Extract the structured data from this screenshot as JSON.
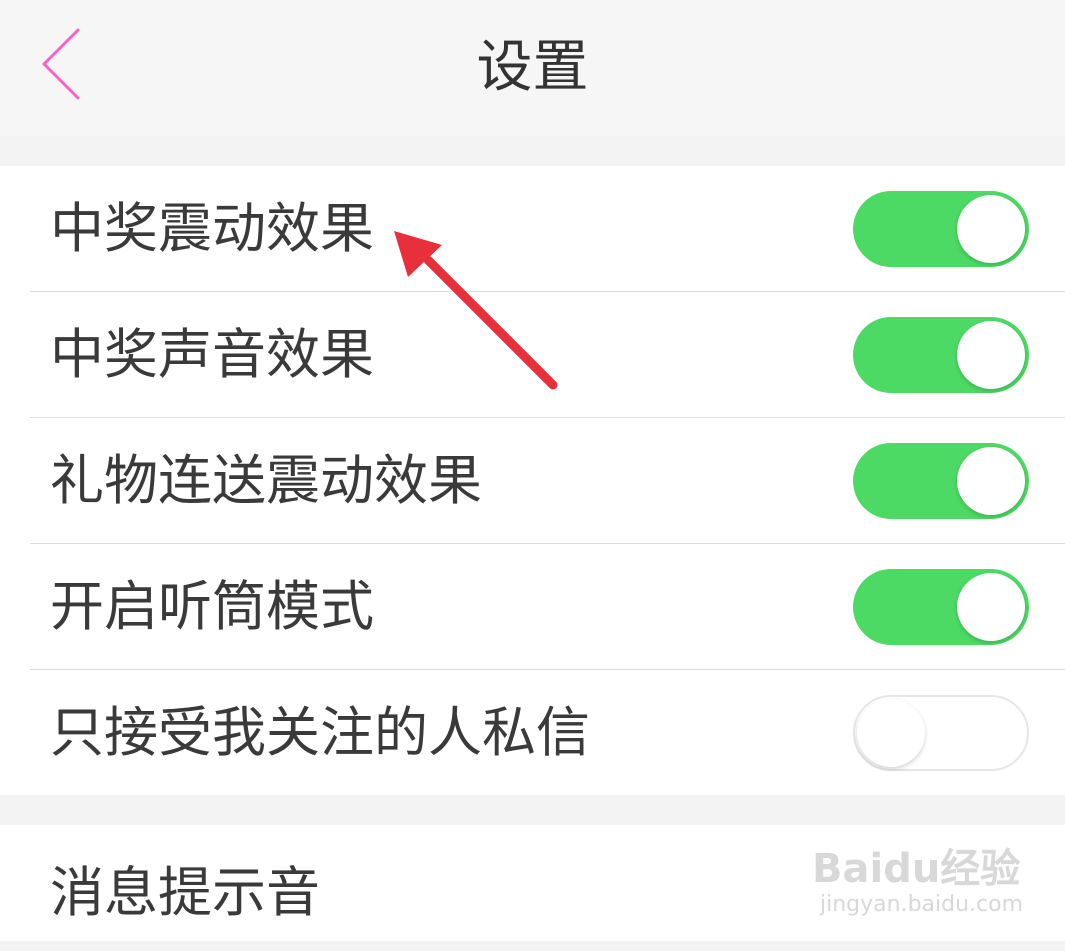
{
  "header": {
    "title": "设置",
    "back_icon": "chevron-left-icon",
    "back_color": "#ff5fc8"
  },
  "settings": [
    {
      "label": "中奖震动效果",
      "enabled": true
    },
    {
      "label": "中奖声音效果",
      "enabled": true
    },
    {
      "label": "礼物连送震动效果",
      "enabled": true
    },
    {
      "label": "开启听筒模式",
      "enabled": true
    },
    {
      "label": "只接受我关注的人私信",
      "enabled": false
    }
  ],
  "group2": {
    "items": [
      {
        "label": "消息提示音"
      }
    ]
  },
  "colors": {
    "switch_on": "#4cd964",
    "annotation_arrow": "#e8303a"
  },
  "watermark": {
    "brand": "Baidu经验",
    "url": "jingyan.baidu.com"
  }
}
